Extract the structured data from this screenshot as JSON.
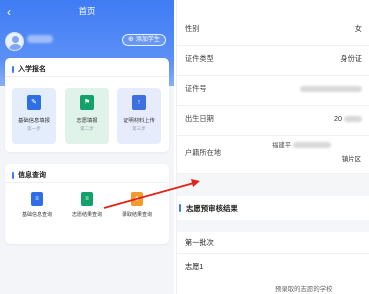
{
  "left_phone": {
    "nav_title": "首页",
    "add_student_label": "添加学生",
    "enroll_card": {
      "title": "入学报名",
      "steps": [
        {
          "label": "基础信息填报",
          "sub": "第一步",
          "icon": "edit-document-icon"
        },
        {
          "label": "志愿填报",
          "sub": "第二步",
          "icon": "flag-document-icon"
        },
        {
          "label": "证明材料上传",
          "sub": "第三步",
          "icon": "upload-document-icon"
        }
      ]
    },
    "info_card": {
      "title": "信息查询",
      "items": [
        {
          "label": "基础信息查询",
          "icon": "info-document-icon"
        },
        {
          "label": "志愿结果查询",
          "icon": "result-document-icon"
        },
        {
          "label": "录取结果查询",
          "icon": "admission-document-icon"
        }
      ]
    }
  },
  "right_panel": {
    "fields": [
      {
        "label": "性别",
        "value": "女"
      },
      {
        "label": "证件类型",
        "value": "身份证"
      },
      {
        "label": "证件号",
        "value": ""
      },
      {
        "label": "出生日期",
        "value": "20"
      },
      {
        "label": "户籍所在地",
        "value_line1": "福建平",
        "value_line2": "镇片区"
      }
    ],
    "section_title": "志愿预审核结果",
    "batch_label": "第一批次",
    "wish_label": "志愿1",
    "wish_value": "预录取的志愿的学校"
  },
  "colors": {
    "primary": "#3f7cf4",
    "green": "#14a06a",
    "orange": "#f29a2e",
    "arrow": "#e2231a"
  }
}
